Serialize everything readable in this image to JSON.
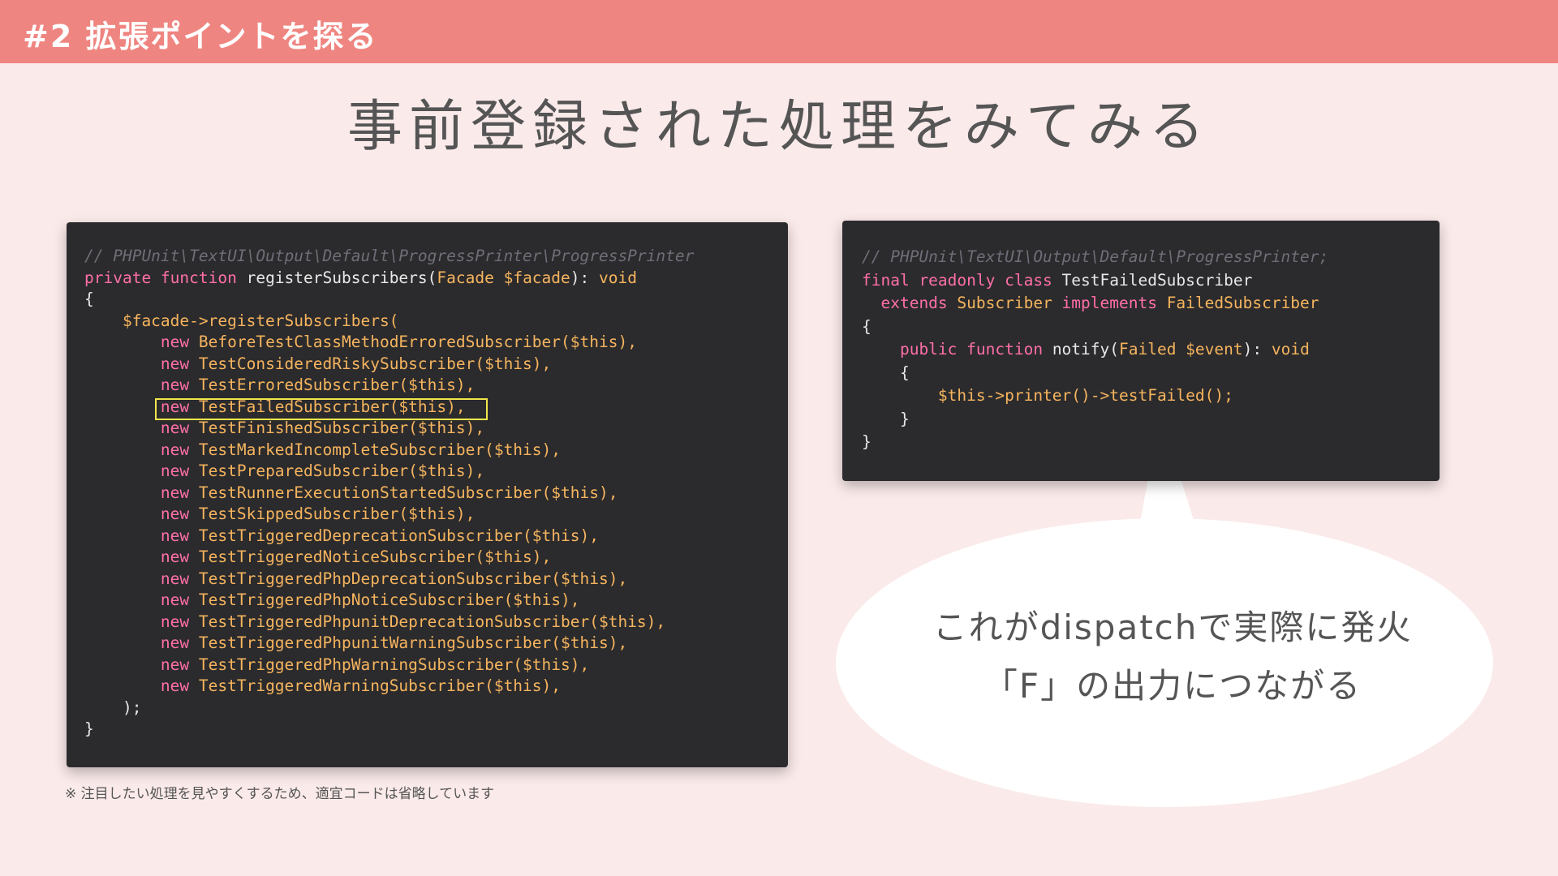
{
  "header": {
    "title": "#2 拡張ポイントを探る"
  },
  "slide": {
    "title": "事前登録された処理をみてみる"
  },
  "left_code": {
    "lines": [
      [
        {
          "t": "// PHPUnit\\TextUI\\Output\\Default\\ProgressPrinter\\ProgressPrinter",
          "c": "comment"
        }
      ],
      [
        {
          "t": "private function ",
          "c": "kw"
        },
        {
          "t": "registerSubscribers(",
          "c": "plain"
        },
        {
          "t": "Facade $facade",
          "c": "type"
        },
        {
          "t": "): ",
          "c": "plain"
        },
        {
          "t": "void",
          "c": "type"
        }
      ],
      [
        {
          "t": "{",
          "c": "plain"
        }
      ],
      [
        {
          "t": "    $facade->registerSubscribers(",
          "c": "var"
        }
      ],
      [
        {
          "t": "        new ",
          "c": "kw"
        },
        {
          "t": "BeforeTestClassMethodErroredSubscriber($this),",
          "c": "type"
        }
      ],
      [
        {
          "t": "        new ",
          "c": "kw"
        },
        {
          "t": "TestConsideredRiskySubscriber($this),",
          "c": "type"
        }
      ],
      [
        {
          "t": "        new ",
          "c": "kw"
        },
        {
          "t": "TestErroredSubscriber($this),",
          "c": "type"
        }
      ],
      [
        {
          "t": "        new ",
          "c": "kw"
        },
        {
          "t": "TestFailedSubscriber($this),",
          "c": "type"
        }
      ],
      [
        {
          "t": "        new ",
          "c": "kw"
        },
        {
          "t": "TestFinishedSubscriber($this),",
          "c": "type"
        }
      ],
      [
        {
          "t": "        new ",
          "c": "kw"
        },
        {
          "t": "TestMarkedIncompleteSubscriber($this),",
          "c": "type"
        }
      ],
      [
        {
          "t": "        new ",
          "c": "kw"
        },
        {
          "t": "TestPreparedSubscriber($this),",
          "c": "type"
        }
      ],
      [
        {
          "t": "        new ",
          "c": "kw"
        },
        {
          "t": "TestRunnerExecutionStartedSubscriber($this),",
          "c": "type"
        }
      ],
      [
        {
          "t": "        new ",
          "c": "kw"
        },
        {
          "t": "TestSkippedSubscriber($this),",
          "c": "type"
        }
      ],
      [
        {
          "t": "        new ",
          "c": "kw"
        },
        {
          "t": "TestTriggeredDeprecationSubscriber($this),",
          "c": "type"
        }
      ],
      [
        {
          "t": "        new ",
          "c": "kw"
        },
        {
          "t": "TestTriggeredNoticeSubscriber($this),",
          "c": "type"
        }
      ],
      [
        {
          "t": "        new ",
          "c": "kw"
        },
        {
          "t": "TestTriggeredPhpDeprecationSubscriber($this),",
          "c": "type"
        }
      ],
      [
        {
          "t": "        new ",
          "c": "kw"
        },
        {
          "t": "TestTriggeredPhpNoticeSubscriber($this),",
          "c": "type"
        }
      ],
      [
        {
          "t": "        new ",
          "c": "kw"
        },
        {
          "t": "TestTriggeredPhpunitDeprecationSubscriber($this),",
          "c": "type"
        }
      ],
      [
        {
          "t": "        new ",
          "c": "kw"
        },
        {
          "t": "TestTriggeredPhpunitWarningSubscriber($this),",
          "c": "type"
        }
      ],
      [
        {
          "t": "        new ",
          "c": "kw"
        },
        {
          "t": "TestTriggeredPhpWarningSubscriber($this),",
          "c": "type"
        }
      ],
      [
        {
          "t": "        new ",
          "c": "kw"
        },
        {
          "t": "TestTriggeredWarningSubscriber($this),",
          "c": "type"
        }
      ],
      [
        {
          "t": "    );",
          "c": "plain"
        }
      ],
      [
        {
          "t": "}",
          "c": "plain"
        }
      ]
    ]
  },
  "right_code": {
    "lines": [
      [
        {
          "t": "// PHPUnit\\TextUI\\Output\\Default\\ProgressPrinter;",
          "c": "comment"
        }
      ],
      [
        {
          "t": "final readonly class ",
          "c": "kw"
        },
        {
          "t": "TestFailedSubscriber",
          "c": "plain"
        }
      ],
      [
        {
          "t": "  extends ",
          "c": "kw"
        },
        {
          "t": "Subscriber ",
          "c": "type"
        },
        {
          "t": "implements ",
          "c": "kw"
        },
        {
          "t": "FailedSubscriber",
          "c": "type"
        }
      ],
      [
        {
          "t": "{",
          "c": "plain"
        }
      ],
      [
        {
          "t": "    public function ",
          "c": "kw"
        },
        {
          "t": "notify(",
          "c": "plain"
        },
        {
          "t": "Failed $event",
          "c": "type"
        },
        {
          "t": "): ",
          "c": "plain"
        },
        {
          "t": "void",
          "c": "type"
        }
      ],
      [
        {
          "t": "    {",
          "c": "plain"
        }
      ],
      [
        {
          "t": "        $this->printer()->testFailed();",
          "c": "var"
        }
      ],
      [
        {
          "t": "    }",
          "c": "plain"
        }
      ],
      [
        {
          "t": "}",
          "c": "plain"
        }
      ]
    ]
  },
  "bubble": {
    "line1": "これがdispatchで実際に発火",
    "line2": "「F」の出力につながる"
  },
  "footnote": "※ 注目したい処理を見やすくするため、適宜コードは省略しています",
  "colors": {
    "header": "#ef8580",
    "background": "#fbeaea",
    "code_bg": "#2b2b2d",
    "keyword": "#ff6fa8",
    "type": "#f6b45e",
    "highlight": "#f1e64b"
  }
}
